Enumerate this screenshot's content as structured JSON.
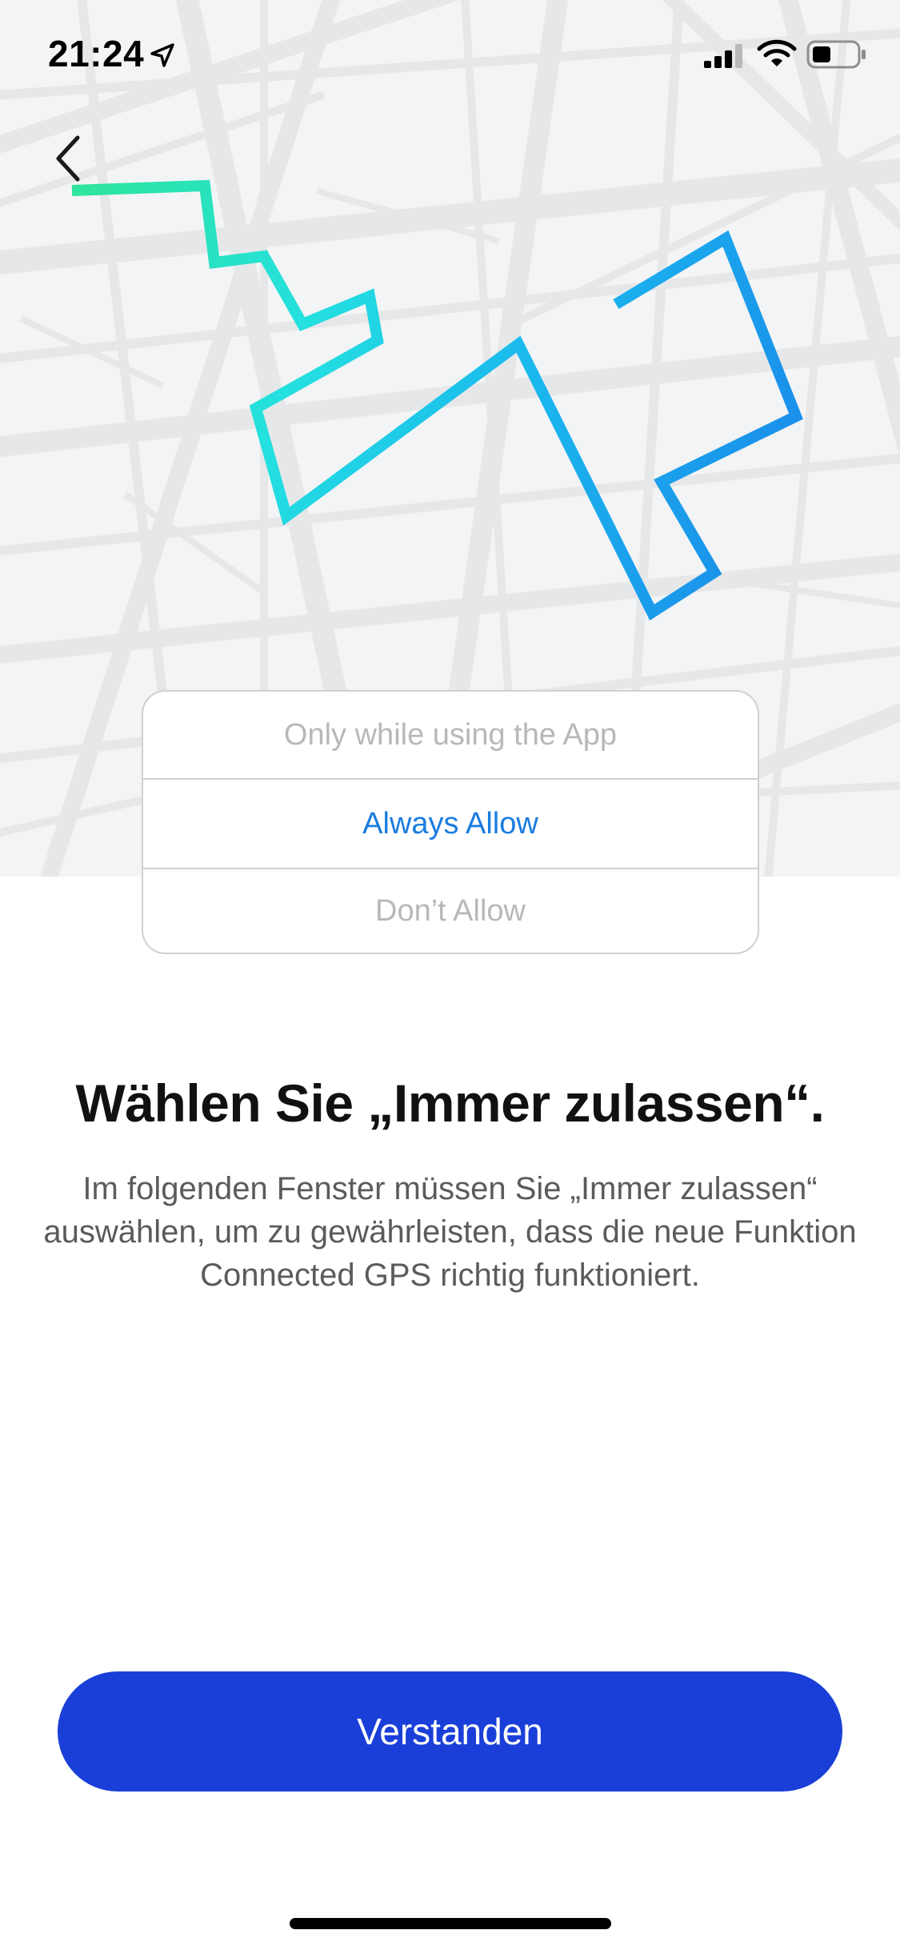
{
  "status_bar": {
    "time": "21:24",
    "icons": [
      "location-arrow-icon",
      "cellular-signal-icon",
      "wifi-icon",
      "battery-icon"
    ]
  },
  "navigation": {
    "back_icon": "chevron-left-icon"
  },
  "illustration": {
    "route_colors": [
      "#2ee59a",
      "#24e0e0",
      "#1ab8ee",
      "#1a90ea"
    ],
    "map_background": "#f3f4f5"
  },
  "permission_dialog": {
    "options": [
      {
        "label": "Only while using the App",
        "state": "dimmed"
      },
      {
        "label": "Always Allow",
        "state": "highlighted"
      },
      {
        "label": "Don’t Allow",
        "state": "dimmed"
      }
    ]
  },
  "content": {
    "title": "Wählen Sie „Immer zulassen“.",
    "description": "Im folgenden Fenster müssen Sie „Immer zulassen“ auswählen, um zu gewährleisten, dass die neue Funktion Connected GPS richtig funktioniert."
  },
  "actions": {
    "confirm_label": "Verstanden"
  },
  "colors": {
    "accent": "#1a3fd8",
    "link_blue": "#1a7ce0",
    "heading": "#111111",
    "body_text": "#5a5b5d"
  }
}
